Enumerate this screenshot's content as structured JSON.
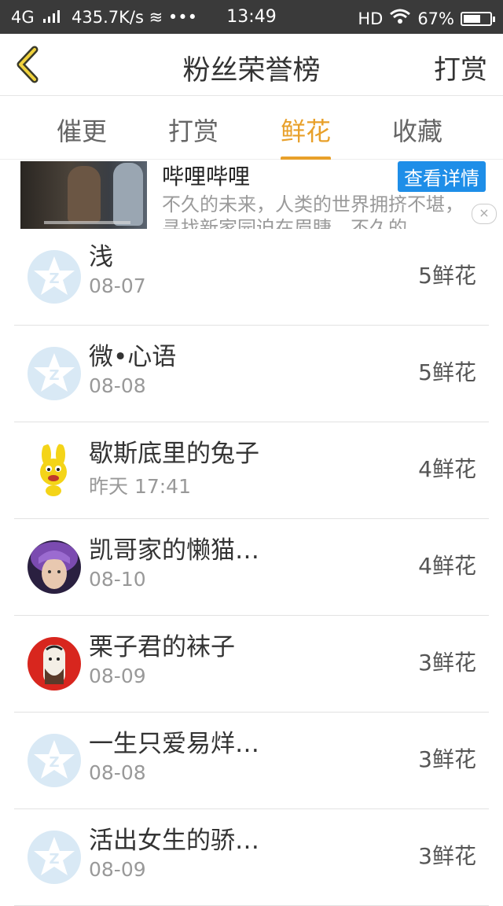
{
  "status_bar": {
    "network": "4G",
    "speed": "435.7K/s",
    "time": "13:49",
    "hd": "HD",
    "battery": "67%",
    "battery_level": 0.67
  },
  "nav": {
    "title": "粉丝荣誉榜",
    "right_action": "打赏"
  },
  "tabs": [
    {
      "label": "催更",
      "active": false
    },
    {
      "label": "打赏",
      "active": false
    },
    {
      "label": "鲜花",
      "active": true
    },
    {
      "label": "收藏",
      "active": false
    }
  ],
  "ad": {
    "title": "哔哩哔哩",
    "button": "查看详情",
    "description": "不久的未来，人类的世界拥挤不堪，寻找新家园迫在眉睫。不久的",
    "close": "×"
  },
  "list": [
    {
      "name": "浅",
      "date": "08-07",
      "count": "5鲜花",
      "avatar": "default"
    },
    {
      "name": "微•心语",
      "date": "08-08",
      "count": "5鲜花",
      "avatar": "default"
    },
    {
      "name": "歇斯底里的兔子",
      "date": "昨天 17:41",
      "count": "4鲜花",
      "avatar": "bunny"
    },
    {
      "name": "凯哥家的懒猫…",
      "date": "08-10",
      "count": "4鲜花",
      "avatar": "purple-hair"
    },
    {
      "name": "栗子君的袜子",
      "date": "08-09",
      "count": "3鲜花",
      "avatar": "red-portrait"
    },
    {
      "name": "一生只爱易烊…",
      "date": "08-08",
      "count": "3鲜花",
      "avatar": "default"
    },
    {
      "name": "活出女生的骄…",
      "date": "08-09",
      "count": "3鲜花",
      "avatar": "default"
    }
  ],
  "colors": {
    "accent": "#e8a02a",
    "status_bar": "#3a3a3a",
    "ad_button": "#1e8ee8"
  }
}
